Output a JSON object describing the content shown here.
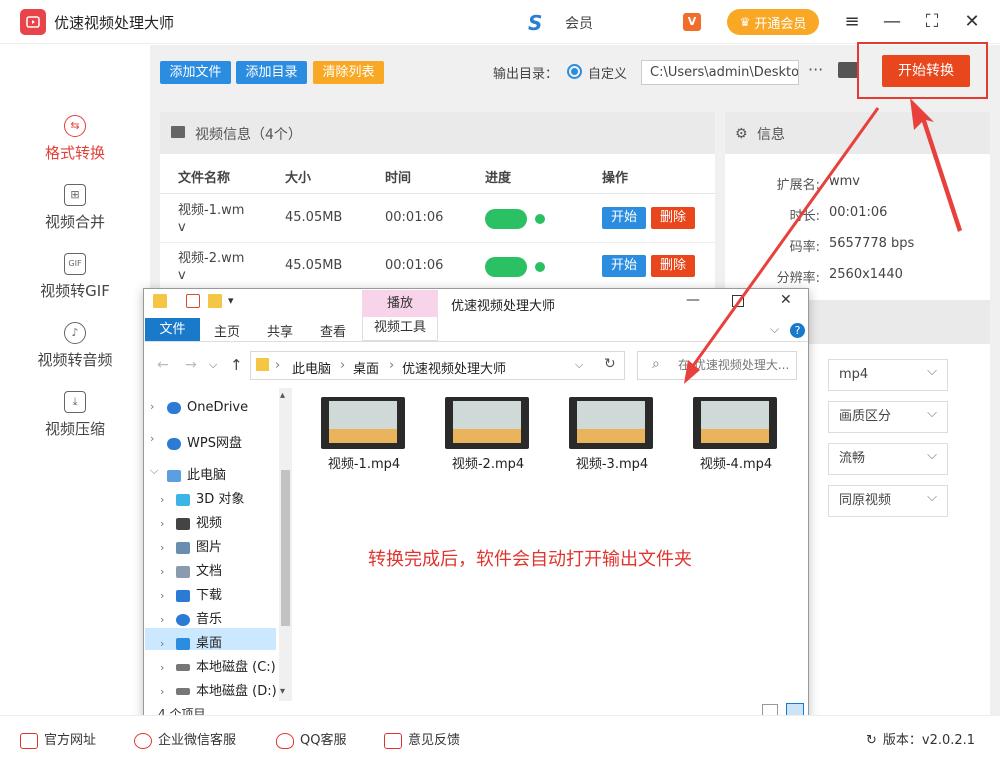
{
  "app": {
    "title": "优速视频处理大师",
    "user_name": "会员",
    "vip_label": "开通会员"
  },
  "window_controls": [
    "≡",
    "—",
    "⛶",
    "✕"
  ],
  "sidebar": {
    "items": [
      {
        "label": "格式转换",
        "icon": "format-convert-icon",
        "active": true
      },
      {
        "label": "视频合并",
        "icon": "merge-icon"
      },
      {
        "label": "视频转GIF",
        "icon": "gif-icon"
      },
      {
        "label": "视频转音频",
        "icon": "audio-icon"
      },
      {
        "label": "视频压缩",
        "icon": "compress-icon"
      }
    ]
  },
  "toolbar": {
    "add_file": "添加文件",
    "add_dir": "添加目录",
    "clear_list": "清除列表",
    "output_label": "输出目录：",
    "radio_label": "自定义",
    "output_path": "C:\\Users\\admin\\Desktop",
    "more": "···",
    "start": "开始转换"
  },
  "video_panel": {
    "title": "视频信息（4个）",
    "columns": [
      "文件名称",
      "大小",
      "时间",
      "进度",
      "操作"
    ],
    "rows": [
      {
        "name_line1": "视频-1.wm",
        "name_line2": "v",
        "size": "45.05MB",
        "time": "00:01:06",
        "start": "开始",
        "delete": "删除"
      },
      {
        "name_line1": "视频-2.wm",
        "name_line2": "v",
        "size": "45.05MB",
        "time": "00:01:06",
        "start": "开始",
        "delete": "删除"
      }
    ]
  },
  "info_panel": {
    "title": "信息",
    "fields": [
      {
        "key": "扩展名:",
        "value": "wmv"
      },
      {
        "key": "时长:",
        "value": "00:01:06"
      },
      {
        "key": "码率:",
        "value": "5657778 bps"
      },
      {
        "key": "分辨率:",
        "value": "2560x1440"
      }
    ],
    "selects": [
      "mp4",
      "画质区分",
      "流畅",
      "同原视频"
    ]
  },
  "explorer": {
    "title": "优速视频处理大师",
    "tabs": {
      "file": "文件",
      "home": "主页",
      "share": "共享",
      "view": "查看",
      "play": "播放",
      "video_tools": "视频工具"
    },
    "breadcrumb": [
      "此电脑",
      "桌面",
      "优速视频处理大师"
    ],
    "search_placeholder": "在 优速视频处理大...",
    "tree": [
      {
        "label": "OneDrive",
        "color": "#2b7bd6"
      },
      {
        "label": "WPS网盘",
        "color": "#2b7bd6"
      },
      {
        "label": "此电脑",
        "color": "#5aa0e0"
      },
      {
        "label": "3D 对象",
        "color": "#3bb5e8"
      },
      {
        "label": "视频",
        "color": "#444"
      },
      {
        "label": "图片",
        "color": "#6a8db0"
      },
      {
        "label": "文档",
        "color": "#8a9bb0"
      },
      {
        "label": "下载",
        "color": "#2b7bd6"
      },
      {
        "label": "音乐",
        "color": "#2b7bd6"
      },
      {
        "label": "桌面",
        "color": "#2b8de0"
      },
      {
        "label": "本地磁盘 (C:)",
        "color": "#777"
      },
      {
        "label": "本地磁盘 (D:)",
        "color": "#777"
      }
    ],
    "files": [
      "视频-1.mp4",
      "视频-2.mp4",
      "视频-3.mp4",
      "视频-4.mp4"
    ],
    "thumb_text": "短视频剪辑技巧",
    "note": "转换完成后，软件会自动打开输出文件夹",
    "item_count": "4 个项目"
  },
  "bottom": {
    "website": "官方网址",
    "wechat": "企业微信客服",
    "qq": "QQ客服",
    "feedback": "意见反馈",
    "version": "版本：v2.0.2.1"
  },
  "colors": {
    "accent": "#e8461d",
    "primary": "#2b8de0",
    "success": "#2bc064",
    "warn": "#f9a826"
  }
}
